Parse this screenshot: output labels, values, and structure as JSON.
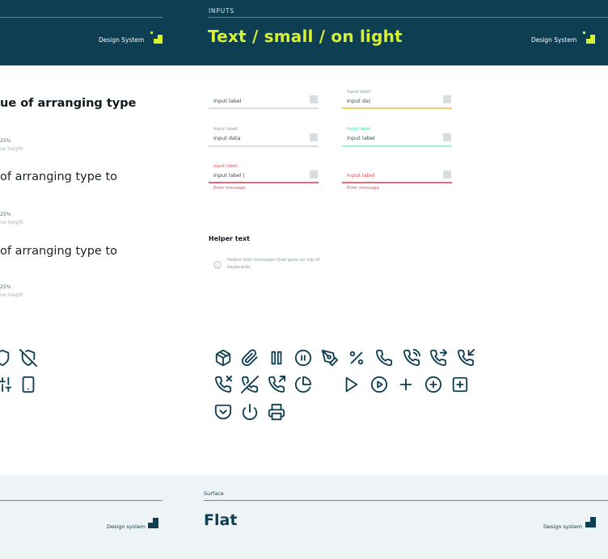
{
  "header": {
    "eyebrow": "INPUTS",
    "title": "Text / small / on light",
    "brand_left": "Design System",
    "brand_right": "Design System"
  },
  "typography": {
    "sample_1": "ue of arranging type",
    "sample_2": "of arranging type to",
    "sample_3": "of arranging type to",
    "meta_value": "25%",
    "meta_caption": "ne height"
  },
  "inputs": {
    "default_label_only": "Input label",
    "typing_label": "Input label",
    "typing_value": "Input da|",
    "filled_label": "Input label",
    "filled_value": "Input data",
    "focus_label": "Input label",
    "focus_value": "Input label",
    "error_label": "Input label",
    "error_value": "Input label |",
    "error_message": "Error message",
    "error2_value": "Input label",
    "error2_message": "Error message"
  },
  "helper": {
    "title": "Helper text",
    "text": "Helper text messages that goes on top of keyboards."
  },
  "icons": [
    "shield-icon",
    "shield-off-icon",
    "sliders-icon",
    "mobile-icon",
    "package-icon",
    "paperclip-icon",
    "pause-icon",
    "pause-circle-icon",
    "pen-tool-icon",
    "percent-icon",
    "phone-icon",
    "phone-call-icon",
    "phone-forwarded-icon",
    "phone-incoming-icon",
    "phone-missed-icon",
    "phone-off-icon",
    "phone-outgoing-icon",
    "pie-chart-icon",
    "play-icon",
    "play-circle-icon",
    "plus-icon",
    "plus-circle-icon",
    "plus-square-icon",
    "pocket-icon",
    "power-icon",
    "printer-icon"
  ],
  "surface": {
    "label": "Surface",
    "title": "Flat",
    "brand_left": "Design system",
    "brand_right": "Design system"
  },
  "colors": {
    "header_bg": "#0e3e52",
    "accent": "#d8f230",
    "error": "#e05060",
    "focus": "#5fe3c0",
    "warning": "#f0d26a",
    "surface_bg": "#eef3f6"
  }
}
